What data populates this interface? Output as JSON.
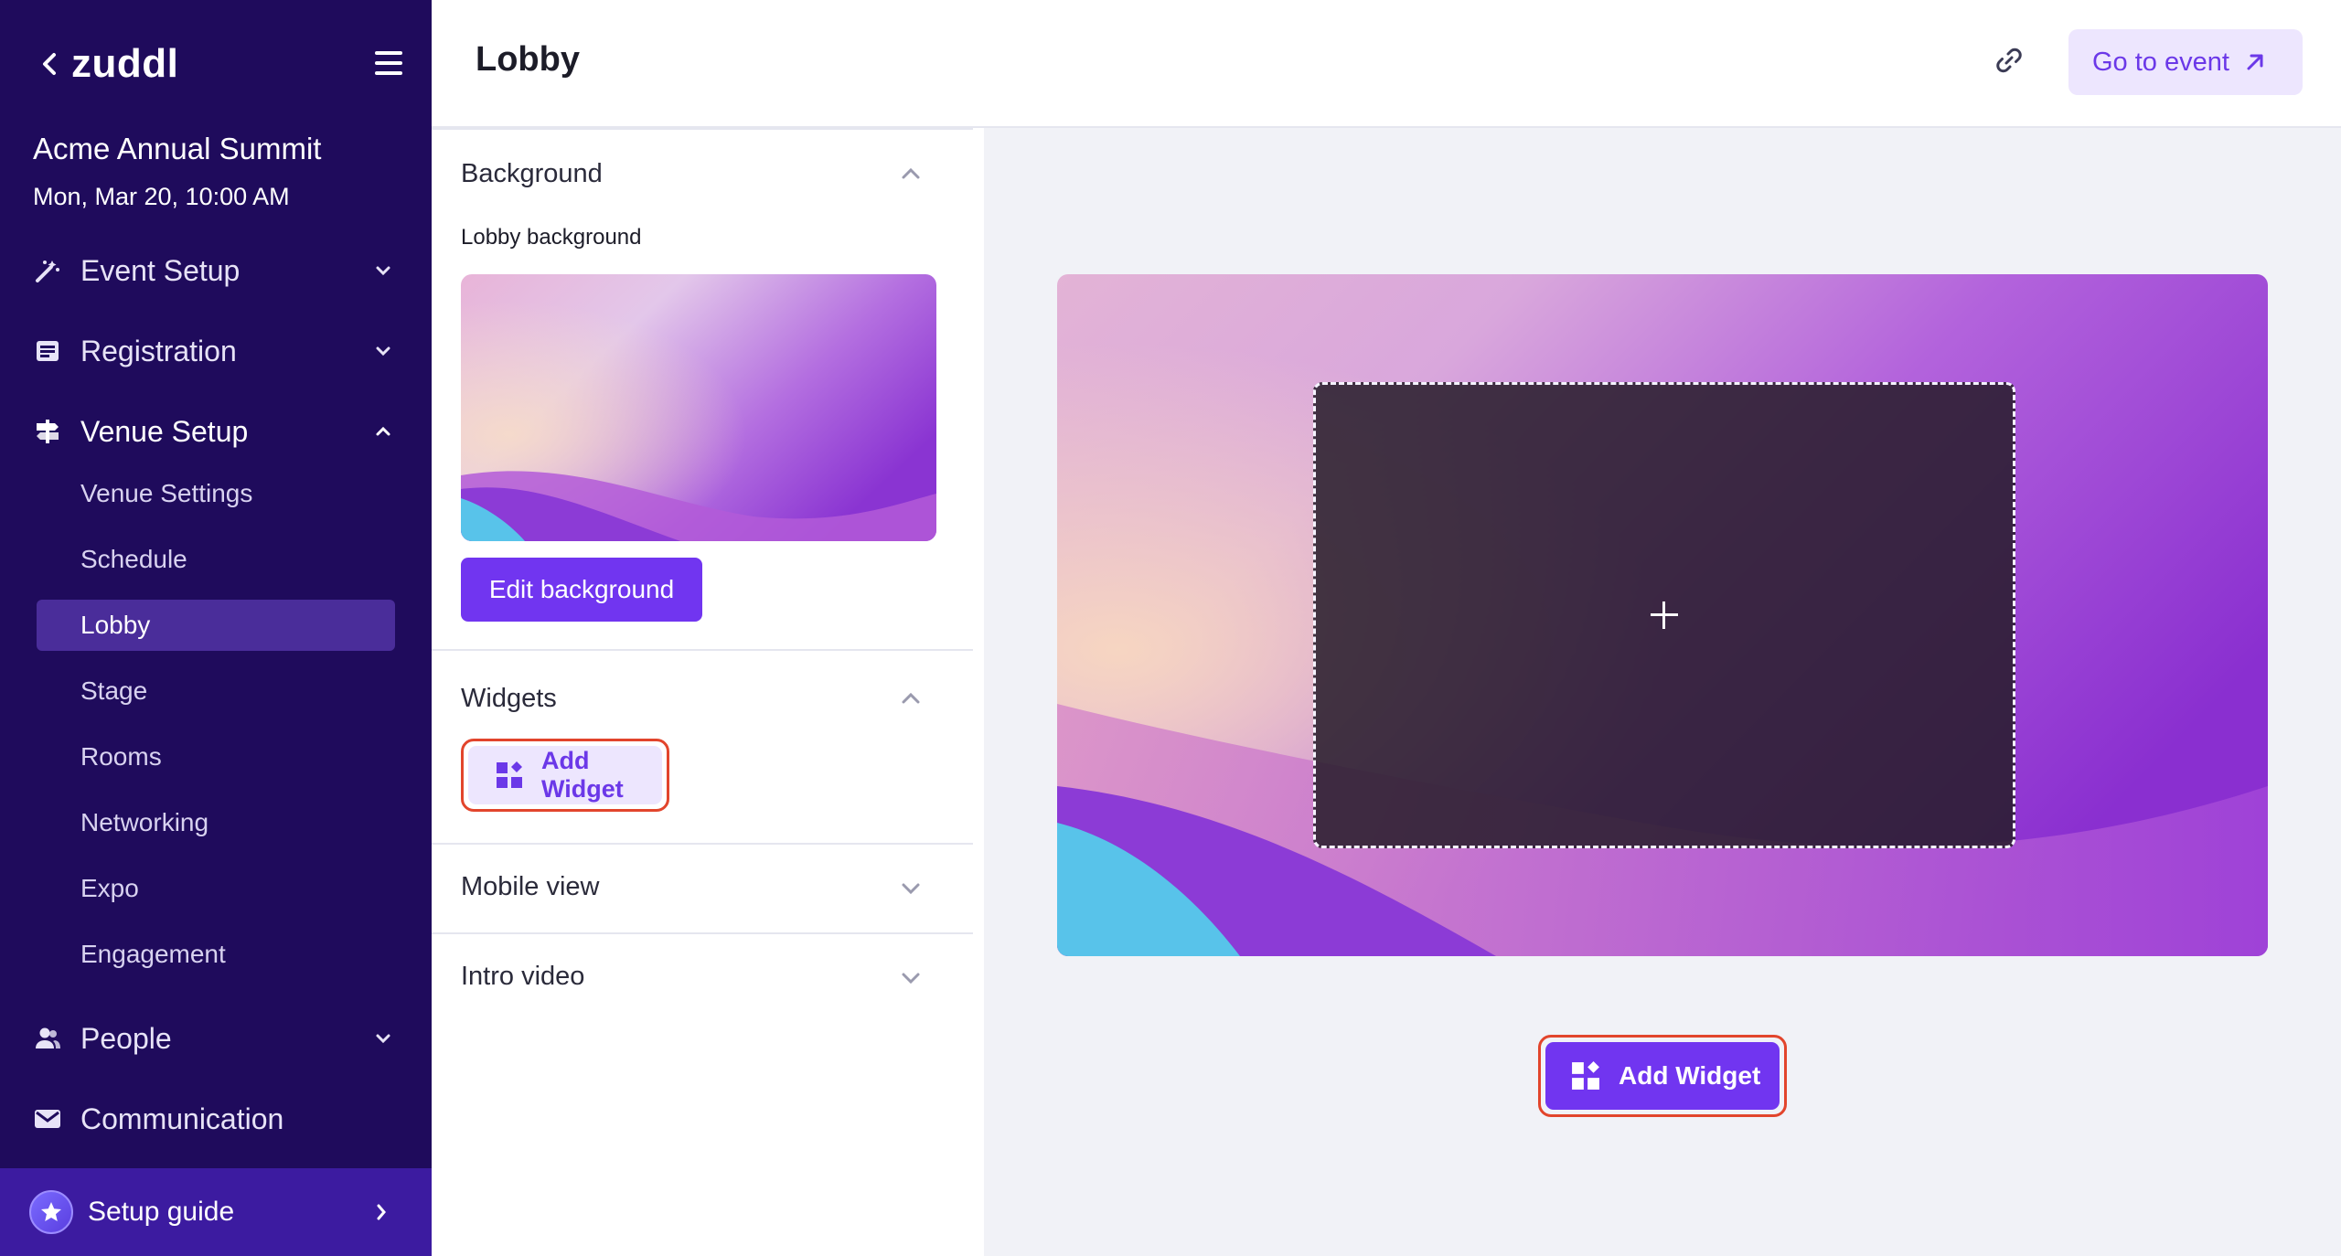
{
  "sidebar": {
    "logo": "zuddl",
    "event_name": "Acme Annual Summit",
    "event_date": "Mon, Mar 20, 10:00 AM",
    "sections": [
      {
        "label": "Event Setup",
        "icon": "magic-wand-icon",
        "expanded": false
      },
      {
        "label": "Registration",
        "icon": "form-icon",
        "expanded": false
      },
      {
        "label": "Venue Setup",
        "icon": "signpost-icon",
        "expanded": true
      },
      {
        "label": "People",
        "icon": "people-icon",
        "expanded": false
      },
      {
        "label": "Communication",
        "icon": "mail-icon",
        "expanded": false
      }
    ],
    "venue_items": [
      {
        "label": "Venue Settings"
      },
      {
        "label": "Schedule"
      },
      {
        "label": "Lobby"
      },
      {
        "label": "Stage"
      },
      {
        "label": "Rooms"
      },
      {
        "label": "Networking"
      },
      {
        "label": "Expo"
      },
      {
        "label": "Engagement"
      }
    ],
    "selected_item": "Lobby",
    "setup_guide": "Setup guide"
  },
  "header": {
    "title": "Lobby",
    "go_to_event": "Go to event"
  },
  "panel": {
    "background": {
      "heading": "Background",
      "caption": "Lobby background",
      "edit_button": "Edit background"
    },
    "widgets": {
      "heading": "Widgets",
      "add_button": "Add Widget"
    },
    "mobile_view": {
      "heading": "Mobile view"
    },
    "intro_video": {
      "heading": "Intro video"
    }
  },
  "canvas": {
    "add_button": "Add Widget"
  },
  "colors": {
    "sidebar_bg": "#1f0b5c",
    "sidebar_selected": "#4a2d9a",
    "setup_guide_bg": "#3c1ba0",
    "accent": "#7135f0",
    "accent_light": "#ede6fe",
    "highlight_outline": "#e2452c"
  }
}
